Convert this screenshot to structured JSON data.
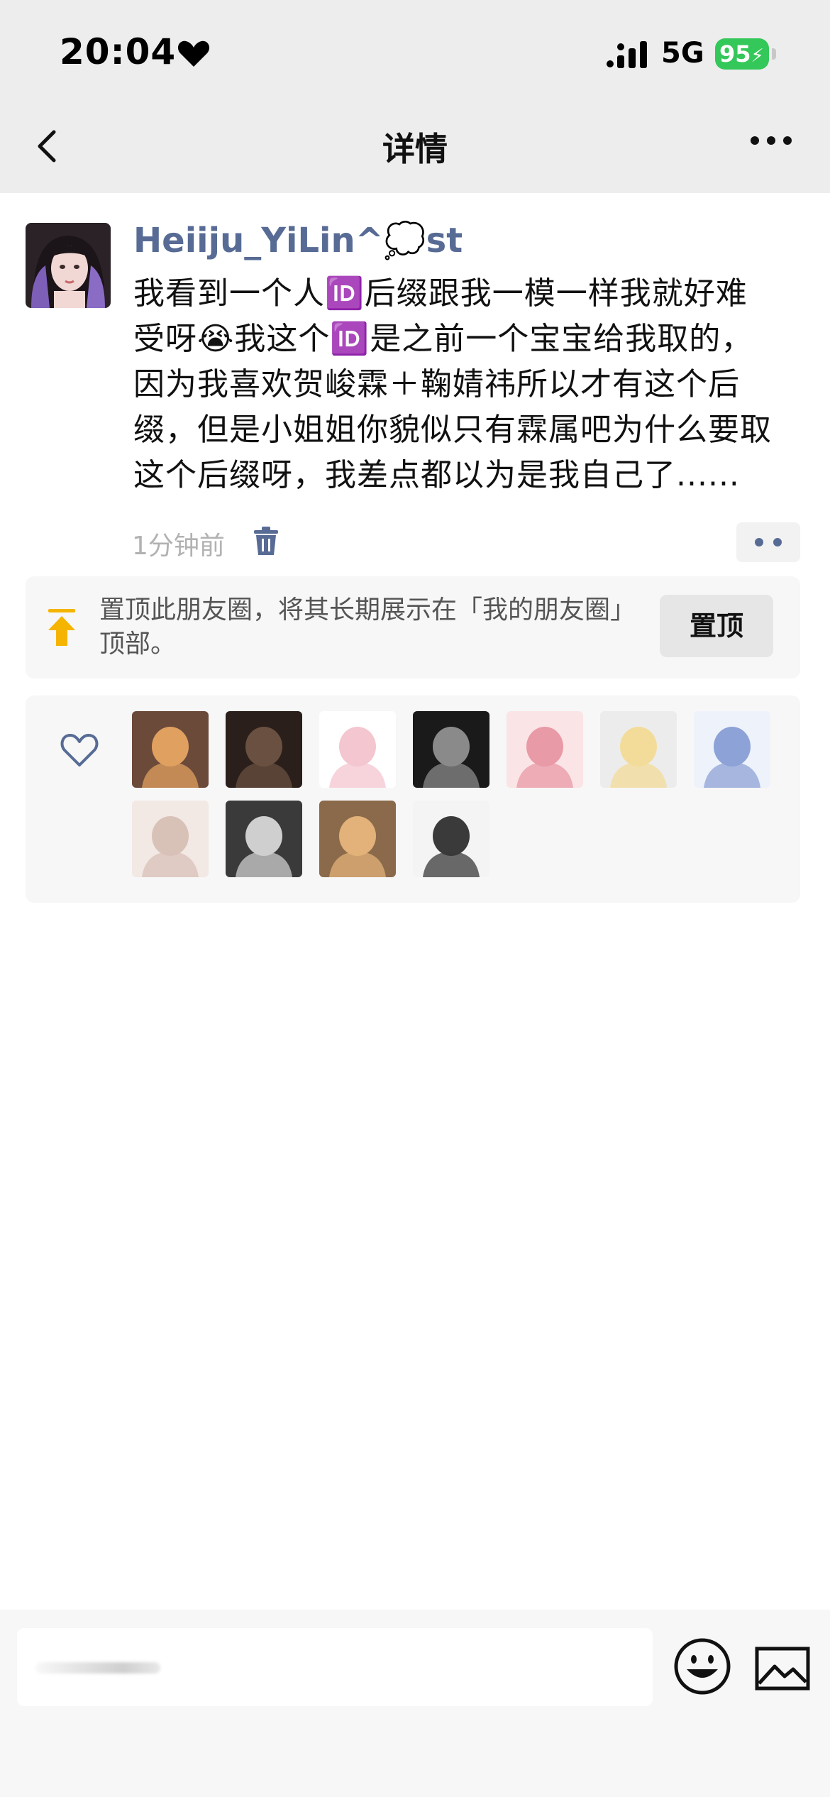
{
  "status_bar": {
    "time": "20:04",
    "network": "5G",
    "battery": "95"
  },
  "nav": {
    "title": "详情"
  },
  "post": {
    "username": "Heiiju_YiLin^💭st",
    "text_lines": [
      "我看到一个人🆔后缀跟我一模一样我就好难",
      "受呀😭我这个🆔是之前一个宝宝给我取的，",
      "因为我喜欢贺峻霖＋鞠婧祎所以才有这个后",
      "缀，但是小姐姐你貌似只有霖属吧为什么要取",
      "这个后缀呀，我差点都以为是我自己了......"
    ],
    "time": "1分钟前"
  },
  "pin": {
    "text": "置顶此朋友圈，将其长期展示在「我的朋友圈」顶部。",
    "button_label": "置顶"
  },
  "likes": {
    "avatars": [
      {
        "icon": "avatar-girl-with-cat",
        "colors": [
          "#6b4a3a",
          "#e0a060"
        ]
      },
      {
        "icon": "avatar-dark-photo",
        "colors": [
          "#2a1f1a",
          "#6a5040"
        ]
      },
      {
        "icon": "avatar-cartoon-bun",
        "colors": [
          "#ffffff",
          "#f4c6d0"
        ]
      },
      {
        "icon": "avatar-bw-anime",
        "colors": [
          "#1a1a1a",
          "#8a8a8a"
        ]
      },
      {
        "icon": "avatar-pink-cartoon-girl",
        "colors": [
          "#fbe4e6",
          "#e89aa6"
        ]
      },
      {
        "icon": "avatar-rilakkuma-bear",
        "colors": [
          "#ececec",
          "#f3dc9a"
        ]
      },
      {
        "icon": "avatar-anime-girl-blue",
        "colors": [
          "#eef2fb",
          "#8da2d6"
        ]
      },
      {
        "icon": "avatar-blonde-girl",
        "colors": [
          "#f2e8e4",
          "#d8c2b8"
        ]
      },
      {
        "icon": "avatar-bw-girl",
        "colors": [
          "#3a3a3a",
          "#cfcfcf"
        ]
      },
      {
        "icon": "avatar-corgi-dog",
        "colors": [
          "#8a6a4a",
          "#e2b27a"
        ]
      },
      {
        "icon": "avatar-girl-twin-tails",
        "colors": [
          "#f4f4f4",
          "#3a3a3a"
        ]
      }
    ]
  },
  "comment": {
    "placeholder": ""
  }
}
